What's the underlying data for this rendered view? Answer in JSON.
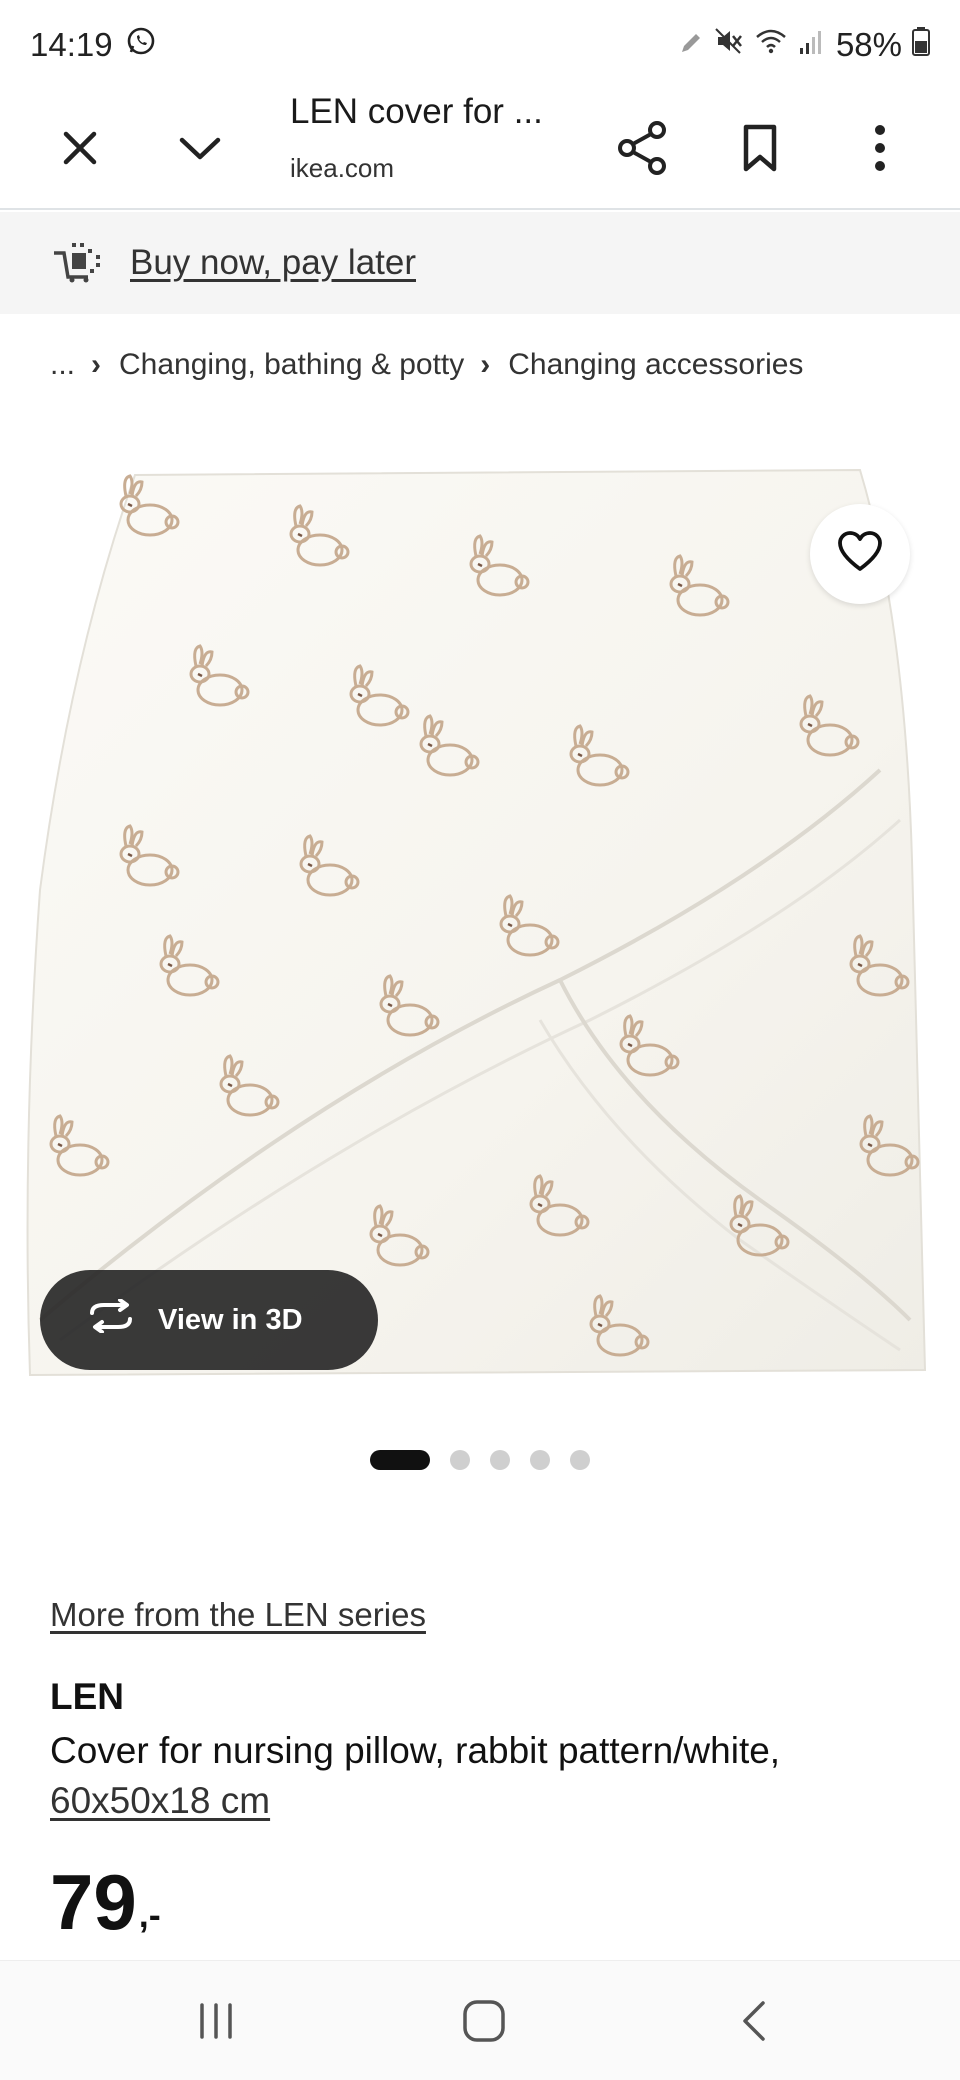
{
  "status_bar": {
    "time": "14:19",
    "battery": "58%",
    "icons": [
      "whatsapp-icon",
      "pen-icon",
      "mute-icon",
      "wifi-icon",
      "signal-icon",
      "battery-icon"
    ]
  },
  "browser": {
    "tab_title": "LEN cover for ...",
    "domain": "ikea.com",
    "icons": [
      "close-icon",
      "chevron-down-icon",
      "share-icon",
      "bookmark-icon",
      "more-vert-icon"
    ]
  },
  "promo": {
    "label": "Buy now, pay later",
    "icon": "cart-installment-icon"
  },
  "breadcrumb": {
    "ellipsis": "...",
    "items": [
      "Changing, bathing & potty",
      "Changing accessories"
    ]
  },
  "gallery": {
    "view_3d_label": "View in 3D",
    "dot_count": 5,
    "active_index": 0,
    "image_alt": "LEN cover for nursing pillow with rabbit pattern"
  },
  "product": {
    "series_link": "More from the LEN series",
    "name": "LEN",
    "description": "Cover for nursing pillow, rabbit pattern/white,",
    "measurement": "60x50x18 cm",
    "price_integer": "79",
    "price_decimal": ",-"
  },
  "colors": {
    "promo_bg": "#f5f5f5",
    "view3d_bg": "#282828",
    "text": "#111111"
  }
}
